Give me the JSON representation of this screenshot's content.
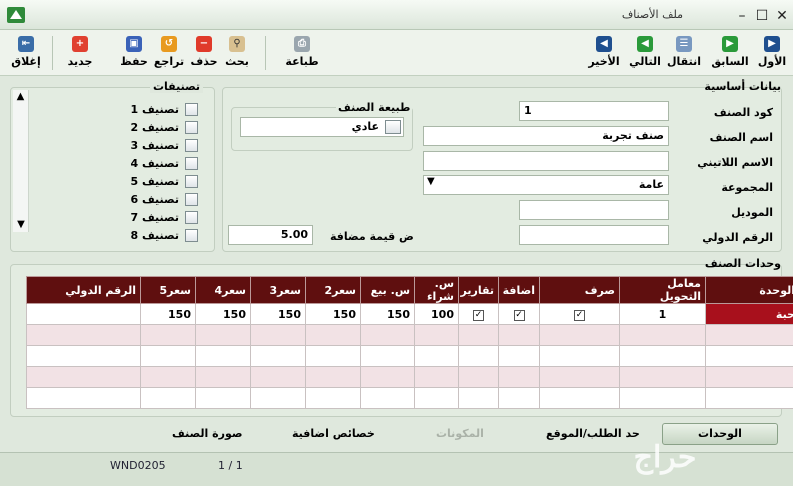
{
  "window": {
    "title": "ملف الأصناف"
  },
  "toolbar": {
    "close": "إغلاق",
    "new": "جديد",
    "save": "حفظ",
    "undo": "تراجع",
    "delete": "حذف",
    "search": "بحث",
    "print": "طباعة",
    "last": "الأخير",
    "next": "التالي",
    "goto": "انتقال",
    "prev": "السابق",
    "first": "الأول"
  },
  "basic": {
    "section_title": "بيانات أساسية",
    "code_label": "كود الصنف",
    "code_value": "1",
    "name_label": "اسم الصنف",
    "name_value": "صنف تجربة",
    "latin_label": "الاسم اللاتيني",
    "latin_value": "",
    "group_label": "المجموعة",
    "group_value": "عامة",
    "model_label": "الموديل",
    "model_value": "",
    "intl_label": "الرقم الدولي",
    "intl_value": "",
    "vat_label": "ض قيمة مضافة",
    "vat_value": "5.00",
    "nature_title": "طبيعة الصنف",
    "nature_value": "عادي"
  },
  "classifications": {
    "title": "تصنيفات",
    "items": [
      "تصنيف 1",
      "تصنيف 2",
      "تصنيف 3",
      "تصنيف 4",
      "تصنيف 5",
      "تصنيف 6",
      "تصنيف 7",
      "تصنيف 8"
    ]
  },
  "units": {
    "section_title": "وحدات الصنف",
    "headers": [
      "الوحدة",
      "معامل التحويل",
      "صرف",
      "اضافة",
      "تقارير",
      "س. شراء",
      "س. بيع",
      "سعر2",
      "سعر3",
      "سعر4",
      "سعر5",
      "الرقم الدولي"
    ],
    "row": {
      "unit": "حبة",
      "factor": "1",
      "buy": "100",
      "sell": "150",
      "p2": "150",
      "p3": "150",
      "p4": "150",
      "p5": "150",
      "intl": ""
    }
  },
  "tabs": {
    "units": "الوحدات",
    "reorder": "حد الطلب/الموقع",
    "components": "المكونات",
    "extra": "خصائص اضافية",
    "image": "صورة الصنف"
  },
  "status": {
    "form_id": "WND0205",
    "record": "1 / 1"
  },
  "watermark": "حراج"
}
